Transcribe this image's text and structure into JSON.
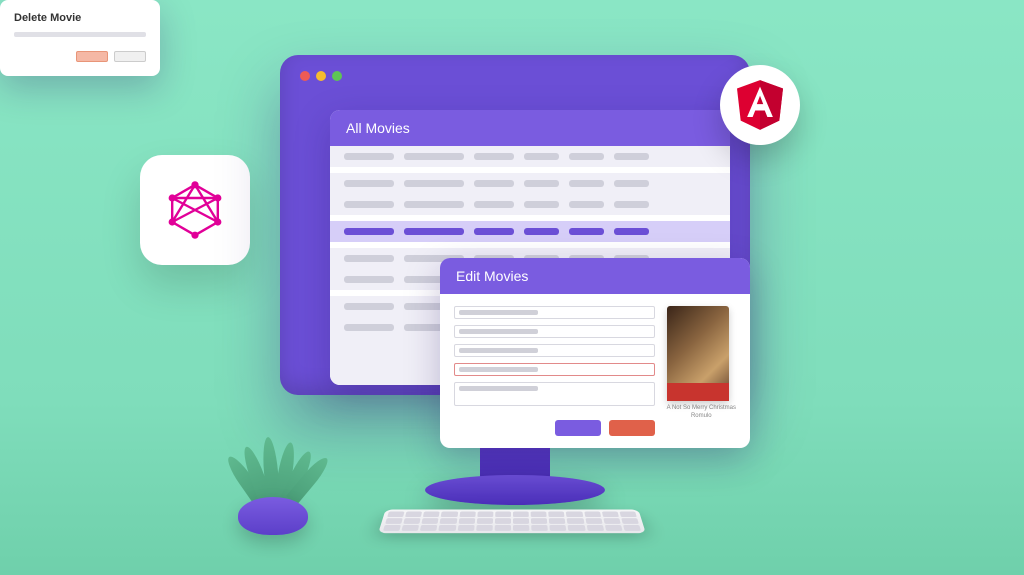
{
  "movies_window": {
    "title": "All Movies"
  },
  "edit_window": {
    "title": "Edit Movies",
    "poster_label": "A Not So Merry Christmas",
    "poster_sublabel": "Romulo"
  },
  "delete_window": {
    "title": "Delete Movie"
  },
  "colors": {
    "primary": "#7a5ce0",
    "danger": "#e0614a"
  },
  "icons": {
    "graphql": "graphql-logo",
    "angular": "angular-logo"
  }
}
